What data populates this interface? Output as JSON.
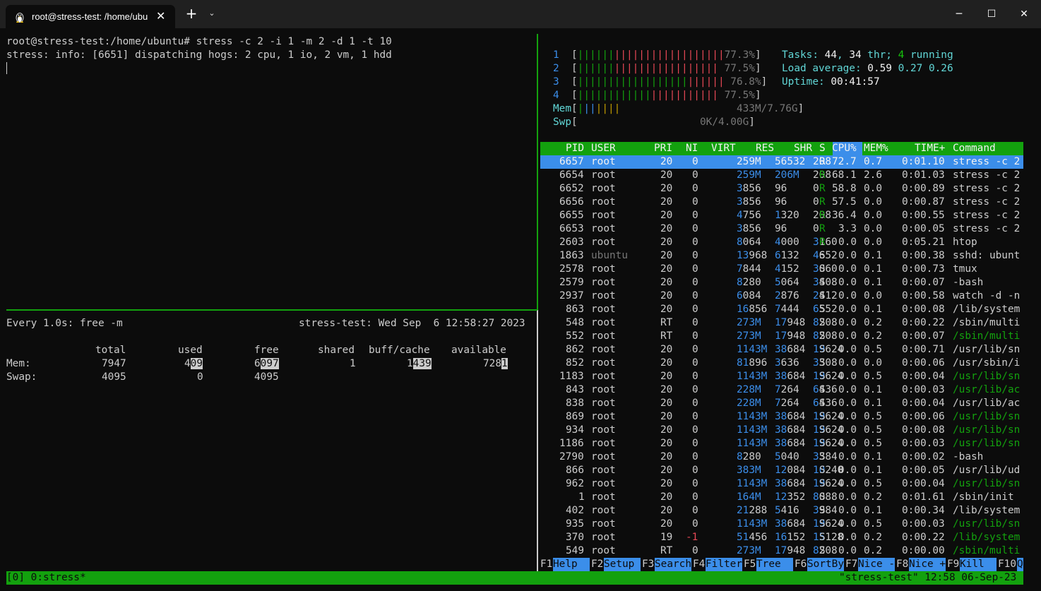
{
  "window": {
    "tab_title": "root@stress-test: /home/ubu",
    "close_glyph": "✕",
    "new_tab_glyph": "+",
    "dropdown_glyph": "⌄",
    "minimize_glyph": "─",
    "maximize_glyph": "☐",
    "close_window_glyph": "✕"
  },
  "shell": {
    "prompt": "root@stress-test:/home/ubuntu# ",
    "command": "stress -c 2 -i 1 -m 2 -d 1 -t 10",
    "output": "stress: info: [6651] dispatching hogs: 2 cpu, 1 io, 2 vm, 1 hdd"
  },
  "watch": {
    "header_left": "Every 1.0s: free -m",
    "header_right": "stress-test: Wed Sep  6 12:58:27 2023",
    "columns": [
      "total",
      "used",
      "free",
      "shared",
      "buff/cache",
      "available"
    ],
    "mem_label": "Mem:",
    "swap_label": "Swap:",
    "mem": {
      "total": "7947",
      "used_a": "4",
      "used_b": "09",
      "free_a": "6",
      "free_b": "097",
      "shared": "1",
      "buff_a": "1",
      "buff_b": "439",
      "avail_a": "728",
      "avail_b": "1"
    },
    "swap": {
      "total": "4095",
      "used": "0",
      "free": "4095"
    }
  },
  "htop": {
    "cpus": [
      {
        "num": "1",
        "g": "||||||",
        "r": "||||||||||||||||||",
        "pct": "77.3%"
      },
      {
        "num": "2",
        "g": "||||||",
        "r": "||||||||||||||||| ",
        "pct": "77.5%"
      },
      {
        "num": "3",
        "g": "||||||||||||||||||",
        "r": "|||||| ",
        "pct": "76.8%"
      },
      {
        "num": "4",
        "g": "||||||||||||",
        "r": "||||||||||| ",
        "pct": "77.5%"
      }
    ],
    "mem_label": "Mem",
    "mem_bar_g": "|",
    "mem_bar_b": "||",
    "mem_bar_y": "||||",
    "mem_value": "433M/7.76G",
    "swp_label": "Swp",
    "swp_value": "0K/4.00G",
    "tasks_label": "Tasks: ",
    "tasks": "44",
    "thr": "34",
    "thr_label": " thr; ",
    "running": "4",
    "running_label": " running",
    "load_label": "Load average: ",
    "load1": "0.59",
    "load5": "0.27",
    "load15": "0.26",
    "uptime_label": "Uptime: ",
    "uptime": "00:41:57",
    "header": [
      "PID",
      "USER",
      "PRI",
      "NI",
      "VIRT",
      "RES",
      "SHR",
      "S",
      "CPU%",
      "MEM%",
      "TIME+",
      "Command"
    ],
    "processes": [
      {
        "pid": "6657",
        "user": "root",
        "pri": "20",
        "ni": "0",
        "virt": "259M",
        "res": "56532",
        "shr": "208",
        "s": "R",
        "cpu": "72.7",
        "mem": "0.7",
        "time": "0:01.10",
        "cmd": "stress -c 2"
      },
      {
        "pid": "6654",
        "user": "root",
        "pri": "20",
        "ni": "0",
        "virt": "259M",
        "res": "206M",
        "shr": "208",
        "s": "R",
        "cpu": "68.1",
        "mem": "2.6",
        "time": "0:01.03",
        "cmd": "stress -c 2"
      },
      {
        "pid": "6652",
        "user": "root",
        "pri": "20",
        "ni": "0",
        "virt": "3856",
        "res": "96",
        "shr": "0",
        "s": "R",
        "cpu": "58.8",
        "mem": "0.0",
        "time": "0:00.89",
        "cmd": "stress -c 2"
      },
      {
        "pid": "6656",
        "user": "root",
        "pri": "20",
        "ni": "0",
        "virt": "3856",
        "res": "96",
        "shr": "0",
        "s": "R",
        "cpu": "57.5",
        "mem": "0.0",
        "time": "0:00.87",
        "cmd": "stress -c 2"
      },
      {
        "pid": "6655",
        "user": "root",
        "pri": "20",
        "ni": "0",
        "virt": "4756",
        "res": "1320",
        "shr": "208",
        "s": "R",
        "cpu": "36.4",
        "mem": "0.0",
        "time": "0:00.55",
        "cmd": "stress -c 2"
      },
      {
        "pid": "6653",
        "user": "root",
        "pri": "20",
        "ni": "0",
        "virt": "3856",
        "res": "96",
        "shr": "0",
        "s": "R",
        "cpu": "3.3",
        "mem": "0.0",
        "time": "0:00.05",
        "cmd": "stress -c 2"
      },
      {
        "pid": "2603",
        "user": "root",
        "pri": "20",
        "ni": "0",
        "virt": "8064",
        "res": "4000",
        "shr": "3160",
        "s": "R",
        "cpu": "0.0",
        "mem": "0.0",
        "time": "0:05.21",
        "cmd": "htop"
      },
      {
        "pid": "1863",
        "user": "ubuntu",
        "pri": "20",
        "ni": "0",
        "virt": "13968",
        "res": "6132",
        "shr": "4652",
        "s": "S",
        "cpu": "0.0",
        "mem": "0.1",
        "time": "0:00.38",
        "cmd": "sshd: ubunt"
      },
      {
        "pid": "2578",
        "user": "root",
        "pri": "20",
        "ni": "0",
        "virt": "7844",
        "res": "4152",
        "shr": "3060",
        "s": "S",
        "cpu": "0.0",
        "mem": "0.1",
        "time": "0:00.73",
        "cmd": "tmux"
      },
      {
        "pid": "2579",
        "user": "root",
        "pri": "20",
        "ni": "0",
        "virt": "8280",
        "res": "5064",
        "shr": "3408",
        "s": "S",
        "cpu": "0.0",
        "mem": "0.1",
        "time": "0:00.07",
        "cmd": "-bash"
      },
      {
        "pid": "2937",
        "user": "root",
        "pri": "20",
        "ni": "0",
        "virt": "6084",
        "res": "2876",
        "shr": "2412",
        "s": "S",
        "cpu": "0.0",
        "mem": "0.0",
        "time": "0:00.58",
        "cmd": "watch -d -n"
      },
      {
        "pid": "863",
        "user": "root",
        "pri": "20",
        "ni": "0",
        "virt": "16856",
        "res": "7444",
        "shr": "6552",
        "s": "S",
        "cpu": "0.0",
        "mem": "0.1",
        "time": "0:00.08",
        "cmd": "/lib/system"
      },
      {
        "pid": "548",
        "user": "root",
        "pri": "RT",
        "ni": "0",
        "virt": "273M",
        "res": "17948",
        "shr": "8208",
        "s": "S",
        "cpu": "0.0",
        "mem": "0.2",
        "time": "0:00.22",
        "cmd": "/sbin/multi"
      },
      {
        "pid": "552",
        "user": "root",
        "pri": "RT",
        "ni": "0",
        "virt": "273M",
        "res": "17948",
        "shr": "8208",
        "s": "S",
        "cpu": "0.0",
        "mem": "0.2",
        "time": "0:00.07",
        "cmd": "/sbin/multi"
      },
      {
        "pid": "862",
        "user": "root",
        "pri": "20",
        "ni": "0",
        "virt": "1143M",
        "res": "38684",
        "shr": "19624",
        "s": "S",
        "cpu": "0.0",
        "mem": "0.5",
        "time": "0:00.71",
        "cmd": "/usr/lib/sn"
      },
      {
        "pid": "852",
        "user": "root",
        "pri": "20",
        "ni": "0",
        "virt": "81896",
        "res": "3636",
        "shr": "3308",
        "s": "S",
        "cpu": "0.0",
        "mem": "0.0",
        "time": "0:00.06",
        "cmd": "/usr/sbin/i"
      },
      {
        "pid": "1183",
        "user": "root",
        "pri": "20",
        "ni": "0",
        "virt": "1143M",
        "res": "38684",
        "shr": "19624",
        "s": "S",
        "cpu": "0.0",
        "mem": "0.5",
        "time": "0:00.04",
        "cmd": "/usr/lib/sn"
      },
      {
        "pid": "843",
        "user": "root",
        "pri": "20",
        "ni": "0",
        "virt": "228M",
        "res": "7264",
        "shr": "6436",
        "s": "S",
        "cpu": "0.0",
        "mem": "0.1",
        "time": "0:00.03",
        "cmd": "/usr/lib/ac"
      },
      {
        "pid": "838",
        "user": "root",
        "pri": "20",
        "ni": "0",
        "virt": "228M",
        "res": "7264",
        "shr": "6436",
        "s": "S",
        "cpu": "0.0",
        "mem": "0.1",
        "time": "0:00.04",
        "cmd": "/usr/lib/ac"
      },
      {
        "pid": "869",
        "user": "root",
        "pri": "20",
        "ni": "0",
        "virt": "1143M",
        "res": "38684",
        "shr": "19624",
        "s": "S",
        "cpu": "0.0",
        "mem": "0.5",
        "time": "0:00.06",
        "cmd": "/usr/lib/sn"
      },
      {
        "pid": "934",
        "user": "root",
        "pri": "20",
        "ni": "0",
        "virt": "1143M",
        "res": "38684",
        "shr": "19624",
        "s": "S",
        "cpu": "0.0",
        "mem": "0.5",
        "time": "0:00.08",
        "cmd": "/usr/lib/sn"
      },
      {
        "pid": "1186",
        "user": "root",
        "pri": "20",
        "ni": "0",
        "virt": "1143M",
        "res": "38684",
        "shr": "19624",
        "s": "S",
        "cpu": "0.0",
        "mem": "0.5",
        "time": "0:00.03",
        "cmd": "/usr/lib/sn"
      },
      {
        "pid": "2790",
        "user": "root",
        "pri": "20",
        "ni": "0",
        "virt": "8280",
        "res": "5040",
        "shr": "3384",
        "s": "S",
        "cpu": "0.0",
        "mem": "0.1",
        "time": "0:00.02",
        "cmd": "-bash"
      },
      {
        "pid": "866",
        "user": "root",
        "pri": "20",
        "ni": "0",
        "virt": "383M",
        "res": "12084",
        "shr": "10240",
        "s": "S",
        "cpu": "0.0",
        "mem": "0.1",
        "time": "0:00.05",
        "cmd": "/usr/lib/ud"
      },
      {
        "pid": "962",
        "user": "root",
        "pri": "20",
        "ni": "0",
        "virt": "1143M",
        "res": "38684",
        "shr": "19624",
        "s": "S",
        "cpu": "0.0",
        "mem": "0.5",
        "time": "0:00.04",
        "cmd": "/usr/lib/sn"
      },
      {
        "pid": "1",
        "user": "root",
        "pri": "20",
        "ni": "0",
        "virt": "164M",
        "res": "12352",
        "shr": "8088",
        "s": "S",
        "cpu": "0.0",
        "mem": "0.2",
        "time": "0:01.61",
        "cmd": "/sbin/init"
      },
      {
        "pid": "402",
        "user": "root",
        "pri": "20",
        "ni": "0",
        "virt": "21288",
        "res": "5416",
        "shr": "3984",
        "s": "S",
        "cpu": "0.0",
        "mem": "0.1",
        "time": "0:00.34",
        "cmd": "/lib/system"
      },
      {
        "pid": "935",
        "user": "root",
        "pri": "20",
        "ni": "0",
        "virt": "1143M",
        "res": "38684",
        "shr": "19624",
        "s": "S",
        "cpu": "0.0",
        "mem": "0.5",
        "time": "0:00.03",
        "cmd": "/usr/lib/sn"
      },
      {
        "pid": "370",
        "user": "root",
        "pri": "19",
        "ni": "-1",
        "virt": "51456",
        "res": "16152",
        "shr": "15128",
        "s": "S",
        "cpu": "0.0",
        "mem": "0.2",
        "time": "0:00.22",
        "cmd": "/lib/system"
      },
      {
        "pid": "549",
        "user": "root",
        "pri": "RT",
        "ni": "0",
        "virt": "273M",
        "res": "17948",
        "shr": "8208",
        "s": "S",
        "cpu": "0.0",
        "mem": "0.2",
        "time": "0:00.00",
        "cmd": "/sbin/multi"
      }
    ],
    "fkeys": [
      {
        "key": "F1",
        "label": "Help  "
      },
      {
        "key": "F2",
        "label": "Setup "
      },
      {
        "key": "F3",
        "label": "Search"
      },
      {
        "key": "F4",
        "label": "Filter"
      },
      {
        "key": "F5",
        "label": "Tree  "
      },
      {
        "key": "F6",
        "label": "SortBy"
      },
      {
        "key": "F7",
        "label": "Nice -"
      },
      {
        "key": "F8",
        "label": "Nice +"
      },
      {
        "key": "F9",
        "label": "Kill  "
      },
      {
        "key": "F10",
        "label": "Q"
      }
    ]
  },
  "tmux": {
    "left": "[0] 0:stress*",
    "right": "\"stress-test\" 12:58 06-Sep-23"
  }
}
